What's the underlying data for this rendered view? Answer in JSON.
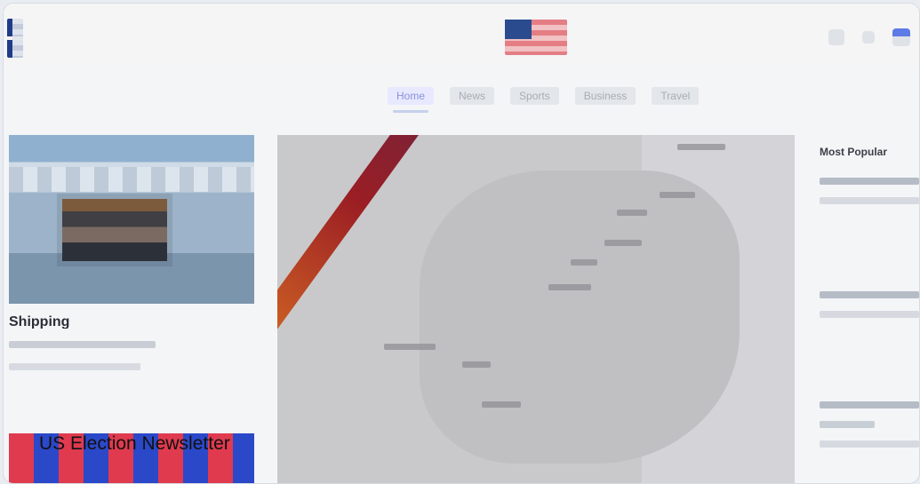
{
  "header": {
    "icons": [
      "search-icon",
      "settings-icon",
      "profile-icon"
    ]
  },
  "nav": {
    "tabs": [
      {
        "label": "Home",
        "active": true
      },
      {
        "label": "News",
        "active": false
      },
      {
        "label": "Sports",
        "active": false
      },
      {
        "label": "Business",
        "active": false
      },
      {
        "label": "Travel",
        "active": false
      }
    ]
  },
  "left": {
    "story_title": "Shipping",
    "newsletter_label": "US Election Newsletter"
  },
  "right": {
    "section_title": "Most Popular"
  },
  "colors": {
    "band_start": "#e09a34",
    "band_mid": "#9b1e24",
    "band_end": "#1b3f84",
    "accent_tab": "#8a92d8"
  }
}
